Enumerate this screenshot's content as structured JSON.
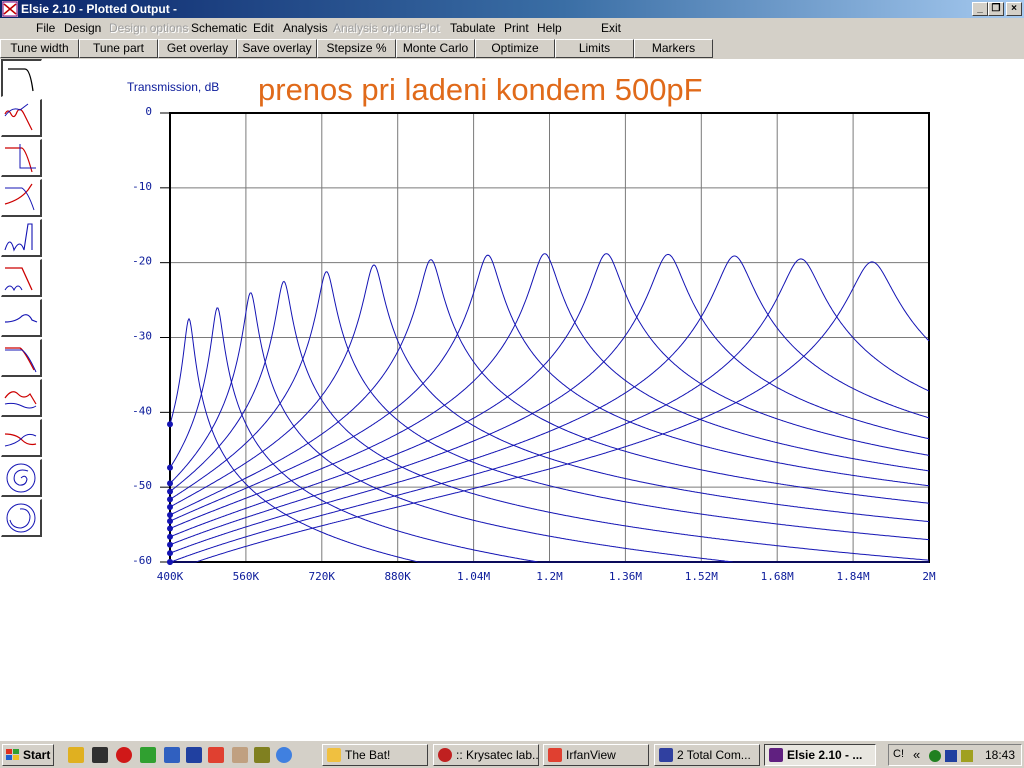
{
  "window": {
    "title": "Elsie 2.10 - Plotted Output -",
    "controls": [
      "_",
      "❐",
      "×"
    ]
  },
  "menu": [
    {
      "label": "File",
      "enabled": true
    },
    {
      "label": "Design",
      "enabled": true
    },
    {
      "label": "Design options",
      "enabled": false
    },
    {
      "label": "Schematic",
      "enabled": true
    },
    {
      "label": "Edit",
      "enabled": true
    },
    {
      "label": "Analysis",
      "enabled": true
    },
    {
      "label": "Analysis options",
      "enabled": false
    },
    {
      "label": "Plot",
      "enabled": false
    },
    {
      "label": "Tabulate",
      "enabled": true
    },
    {
      "label": "Print",
      "enabled": true
    },
    {
      "label": "Help",
      "enabled": true
    },
    {
      "label": "Exit",
      "enabled": true
    }
  ],
  "toolbar": [
    "Tune width",
    "Tune part",
    "Get overlay",
    "Save overlay",
    "Stepsize %",
    "Monte Carlo",
    "Optimize",
    "Limits",
    "Markers"
  ],
  "palette": [
    "lowpass-response-icon",
    "ripple-response-icon",
    "rolloff-response-icon",
    "group-delay-icon",
    "notch-response-icon",
    "mixed-response-icon",
    "hump-response-icon",
    "slope-response-icon",
    "dual-curve-icon",
    "crossing-curve-icon",
    "spiral-icon",
    "smith-circle-icon"
  ],
  "plot_title": "prenos pri ladeni kondem 500pF",
  "chart_data": {
    "type": "line",
    "ylabel": "Transmission, dB",
    "y_ticks": [
      "0",
      "-10",
      "-20",
      "-30",
      "-40",
      "-50",
      "-60"
    ],
    "x_ticks": [
      "400K",
      "560K",
      "720K",
      "880K",
      "1.04M",
      "1.2M",
      "1.36M",
      "1.52M",
      "1.68M",
      "1.84M",
      "2M"
    ],
    "xlim": [
      400000,
      2000000
    ],
    "ylim": [
      -60,
      0
    ],
    "grid": true,
    "line_color": "#1414b4",
    "series": [
      {
        "peak_freq": 440000,
        "peak_db": -27.5
      },
      {
        "peak_freq": 500000,
        "peak_db": -26.0
      },
      {
        "peak_freq": 570000,
        "peak_db": -24.0
      },
      {
        "peak_freq": 640000,
        "peak_db": -22.5
      },
      {
        "peak_freq": 730000,
        "peak_db": -21.2
      },
      {
        "peak_freq": 830000,
        "peak_db": -20.3
      },
      {
        "peak_freq": 950000,
        "peak_db": -19.6
      },
      {
        "peak_freq": 1070000,
        "peak_db": -19.0
      },
      {
        "peak_freq": 1190000,
        "peak_db": -18.8
      },
      {
        "peak_freq": 1320000,
        "peak_db": -18.8
      },
      {
        "peak_freq": 1450000,
        "peak_db": -18.9
      },
      {
        "peak_freq": 1590000,
        "peak_db": -19.1
      },
      {
        "peak_freq": 1730000,
        "peak_db": -19.5
      },
      {
        "peak_freq": 1880000,
        "peak_db": -19.9
      }
    ]
  },
  "taskbar": {
    "start_label": "Start",
    "quicklaunch": [
      "the-bat-icon",
      "tray-icon",
      "opera-icon",
      "frog-icon",
      "shield-icon",
      "floppy-icon",
      "irfanview-icon",
      "book-icon",
      "cd-icon",
      "ie-icon"
    ],
    "tasks": [
      {
        "label": "The Bat!",
        "active": false,
        "icon_color": "#f0c040"
      },
      {
        "label": ":: Krysatec lab...",
        "active": false,
        "icon_color": "#c02020"
      },
      {
        "label": "IrfanView",
        "active": false,
        "icon_color": "#e04030"
      },
      {
        "label": "2 Total Com...",
        "active": false,
        "icon_color": "#3040a0"
      },
      {
        "label": "Elsie 2.10 - ...",
        "active": true,
        "icon_color": "#602080"
      }
    ],
    "tray_label": "C!",
    "clock": "18:43"
  }
}
